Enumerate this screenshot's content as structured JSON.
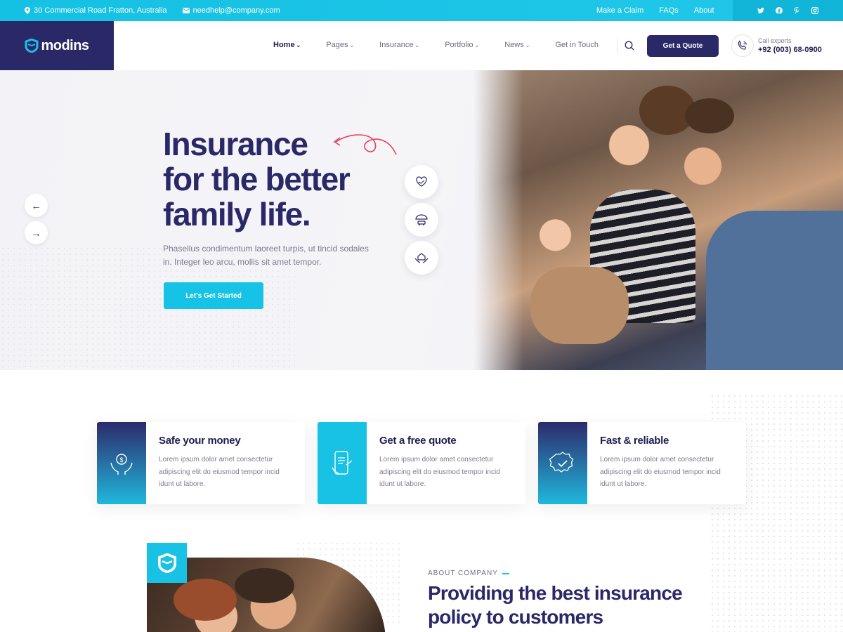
{
  "topbar": {
    "address": "30 Commercial Road Fratton, Australia",
    "email": "needhelp@company.com",
    "links": [
      "Make a Claim",
      "FAQs",
      "About"
    ],
    "social": [
      "twitter-icon",
      "facebook-icon",
      "pinterest-icon",
      "instagram-icon"
    ]
  },
  "header": {
    "logo_text": "modins",
    "nav": [
      {
        "label": "Home",
        "dropdown": true
      },
      {
        "label": "Pages",
        "dropdown": true
      },
      {
        "label": "Insurance",
        "dropdown": true
      },
      {
        "label": "Portfolio",
        "dropdown": true
      },
      {
        "label": "News",
        "dropdown": true
      },
      {
        "label": "Get in Touch",
        "dropdown": false
      }
    ],
    "quote_button": "Get a Quote",
    "call_label": "Call experts",
    "call_number": "+92 (003) 68-0900"
  },
  "hero": {
    "title_line1": "Insurance",
    "title_line2": "for the better",
    "title_line3": "family life.",
    "subtitle": "Phasellus condimentum laoreet turpis, ut tincid sodales in. Integer leo arcu, mollis sit amet tempor.",
    "cta": "Let's Get Started",
    "prev_arrow": "←",
    "next_arrow": "→",
    "icons": [
      "heart-hand-icon",
      "car-umbrella-icon",
      "house-hands-icon"
    ]
  },
  "features": [
    {
      "title": "Safe your money",
      "desc": "Lorem ipsum dolor amet consectetur adipiscing elit do eiusmod tempor incid idunt ut labore.",
      "icon": "money-hands-icon"
    },
    {
      "title": "Get a free quote",
      "desc": "Lorem ipsum dolor amet consectetur adipiscing elit do eiusmod tempor incid idunt ut labore.",
      "icon": "phone-quote-icon"
    },
    {
      "title": "Fast & reliable",
      "desc": "Lorem ipsum dolor amet consectetur adipiscing elit do eiusmod tempor incid idunt ut labore.",
      "icon": "badge-check-icon"
    }
  ],
  "about": {
    "label": "ABOUT COMPANY",
    "title_line1": "Providing the best insurance",
    "title_line2": "policy to customers"
  },
  "colors": {
    "primary": "#2b2868",
    "accent": "#16c2e5",
    "text_muted": "#7d7c94"
  }
}
